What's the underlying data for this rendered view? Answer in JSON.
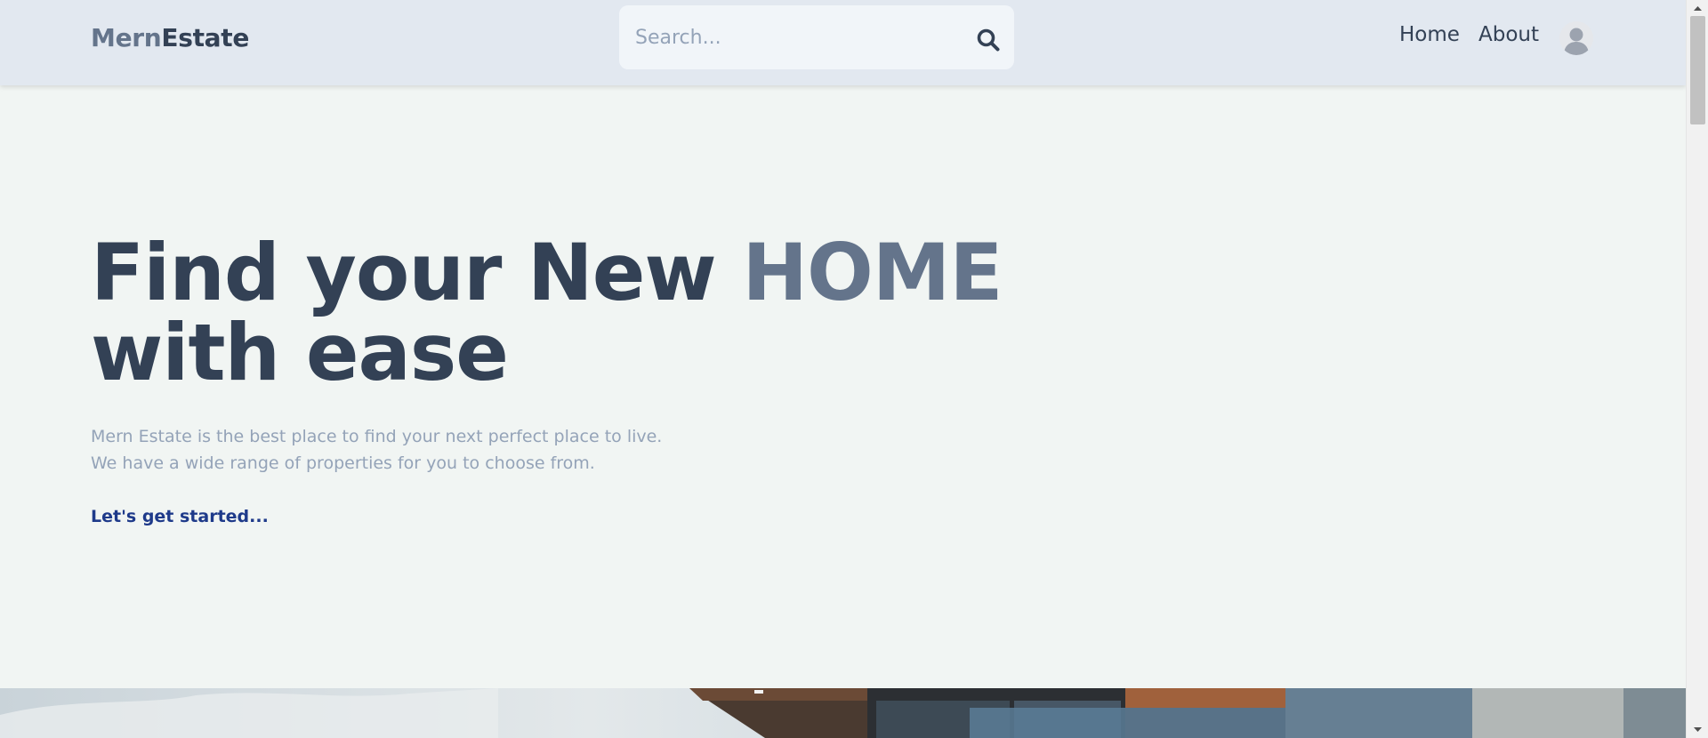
{
  "header": {
    "logo_part1": "Mern",
    "logo_part2": "Estate",
    "search": {
      "placeholder": "Search...",
      "icon": "search-icon"
    },
    "nav": {
      "home": "Home",
      "about": "About"
    },
    "avatar_icon": "user-avatar-icon"
  },
  "hero": {
    "title_part1": "Find your New ",
    "title_accent": "HOME",
    "title_part2": "with ease",
    "desc_line1": "Mern Estate is the best place to find your next perfect place to live.",
    "desc_line2": "We have a wide range of properties for you to choose from.",
    "cta": "Let's get started..."
  },
  "colors": {
    "header_bg": "#e2e8f0",
    "page_bg": "#f1f5f3",
    "text_dark": "#334155",
    "text_accent": "#64748b",
    "text_muted": "#94a3b8",
    "link": "#1e3a8a"
  }
}
